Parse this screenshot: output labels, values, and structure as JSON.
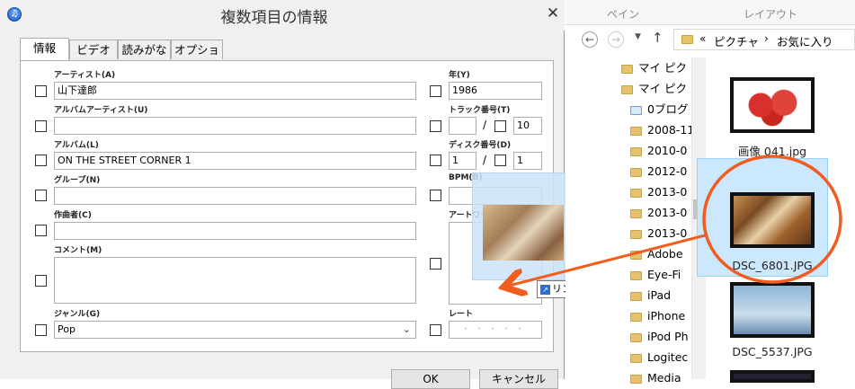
{
  "dialog": {
    "title": "複数項目の情報",
    "close_glyph": "✕",
    "app_icon_glyph": "♫",
    "tabs": [
      {
        "label": "情報",
        "active": true
      },
      {
        "label": "ビデオ",
        "active": false
      },
      {
        "label": "読みがな",
        "active": false
      },
      {
        "label": "オプション",
        "active": false
      }
    ],
    "fields": {
      "artist": {
        "label": "アーティスト(A)",
        "value": "山下達郎"
      },
      "album_artist": {
        "label": "アルバムアーティスト(U)",
        "value": ""
      },
      "album": {
        "label": "アルバム(L)",
        "value": "ON THE STREET CORNER 1"
      },
      "group": {
        "label": "グループ(N)",
        "value": ""
      },
      "composer": {
        "label": "作曲者(C)",
        "value": ""
      },
      "comment": {
        "label": "コメント(M)",
        "value": ""
      },
      "genre": {
        "label": "ジャンル(G)",
        "value": "Pop"
      },
      "year": {
        "label": "年(Y)",
        "value": "1986"
      },
      "track": {
        "label": "トラック番号(T)",
        "value": "",
        "of": "10",
        "separator": "/"
      },
      "disc": {
        "label": "ディスク番号(D)",
        "value": "1",
        "of": "1",
        "separator": "/"
      },
      "bpm": {
        "label": "BPM(B)",
        "value": ""
      },
      "artwork": {
        "label": "アートワーク"
      },
      "rating": {
        "label": "レート",
        "stars": "・・・・・"
      }
    },
    "drag_tooltip": "リンク",
    "buttons": {
      "ok": "OK",
      "cancel": "キャンセル"
    }
  },
  "explorer": {
    "ribbon_tabs": [
      "ペイン",
      "レイアウト"
    ],
    "address": {
      "prefix": "«",
      "path": [
        "ピクチャ",
        "お気に入り"
      ],
      "separator": "›"
    },
    "tree": [
      {
        "label": "マイ ピクチャ",
        "icon": "pinned-folder"
      },
      {
        "label": "マイ ピクチャ",
        "icon": "pinned-folder"
      },
      {
        "label": "0ブログ",
        "icon": "library"
      },
      {
        "label": "2008-11",
        "icon": "folder"
      },
      {
        "label": "2010-0",
        "icon": "folder"
      },
      {
        "label": "2012-0",
        "icon": "folder"
      },
      {
        "label": "2013-0",
        "icon": "folder"
      },
      {
        "label": "2013-0",
        "icon": "folder"
      },
      {
        "label": "2013-0",
        "icon": "folder"
      },
      {
        "label": "Adobe",
        "icon": "folder"
      },
      {
        "label": "Eye-Fi",
        "icon": "folder"
      },
      {
        "label": "iPad",
        "icon": "folder"
      },
      {
        "label": "iPhone",
        "icon": "folder"
      },
      {
        "label": "iPod Ph",
        "icon": "folder"
      },
      {
        "label": "Logitec",
        "icon": "folder"
      },
      {
        "label": "Media",
        "icon": "folder"
      }
    ],
    "files": [
      {
        "name": "画像 041.jpg",
        "selected": false
      },
      {
        "name": "DSC_6801.JPG",
        "selected": true
      },
      {
        "name": "DSC_5537.JPG",
        "selected": false
      }
    ]
  },
  "colors": {
    "annotation": "#f25c1f",
    "selection": "#cce8ff",
    "accent": "#2a6fd1"
  }
}
